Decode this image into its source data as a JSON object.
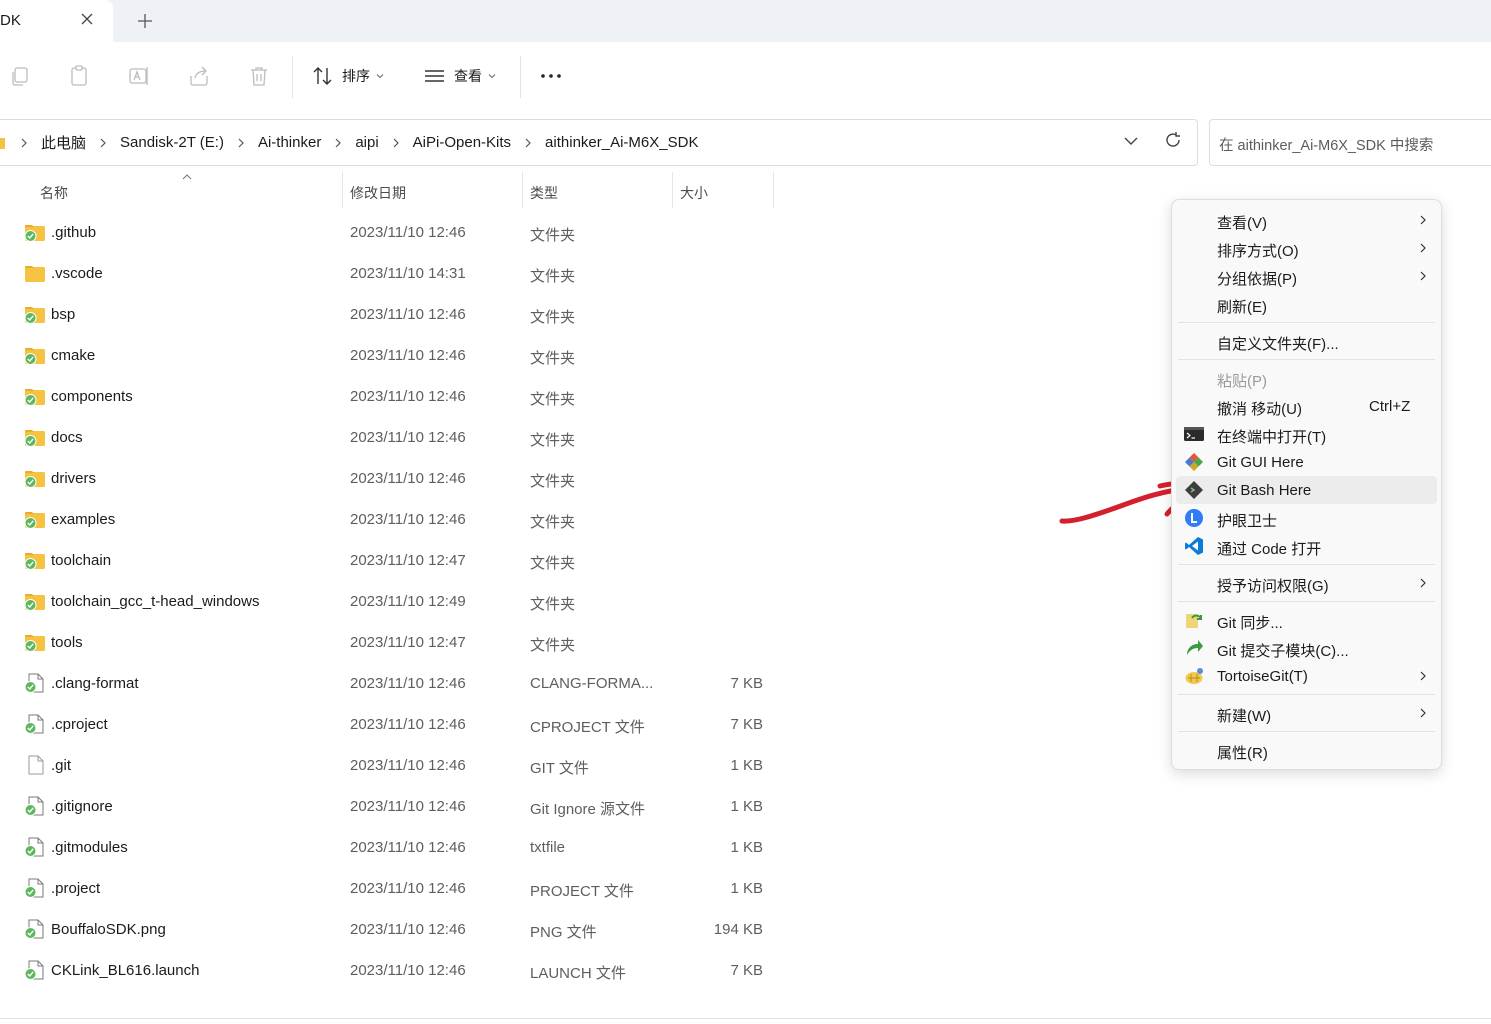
{
  "window": {
    "tab_title": "DK",
    "new_tab_label": "+"
  },
  "toolbar": {
    "sort_label": "排序",
    "view_label": "查看",
    "more_label": "..."
  },
  "address": {
    "breadcrumbs": [
      "此电脑",
      "Sandisk-2T (E:)",
      "Ai-thinker",
      "aipi",
      "AiPi-Open-Kits",
      "aithinker_Ai-M6X_SDK"
    ],
    "search_placeholder": "在 aithinker_Ai-M6X_SDK 中搜索"
  },
  "columns": {
    "name": "名称",
    "date": "修改日期",
    "type": "类型",
    "size": "大小"
  },
  "files": [
    {
      "name": ".github",
      "date": "2023/11/10 12:46",
      "type": "文件夹",
      "size": "",
      "icon": "folder-synced-icon"
    },
    {
      "name": ".vscode",
      "date": "2023/11/10 14:31",
      "type": "文件夹",
      "size": "",
      "icon": "folder-icon"
    },
    {
      "name": "bsp",
      "date": "2023/11/10 12:46",
      "type": "文件夹",
      "size": "",
      "icon": "folder-synced-icon"
    },
    {
      "name": "cmake",
      "date": "2023/11/10 12:46",
      "type": "文件夹",
      "size": "",
      "icon": "folder-synced-icon"
    },
    {
      "name": "components",
      "date": "2023/11/10 12:46",
      "type": "文件夹",
      "size": "",
      "icon": "folder-synced-icon"
    },
    {
      "name": "docs",
      "date": "2023/11/10 12:46",
      "type": "文件夹",
      "size": "",
      "icon": "folder-synced-icon"
    },
    {
      "name": "drivers",
      "date": "2023/11/10 12:46",
      "type": "文件夹",
      "size": "",
      "icon": "folder-synced-icon"
    },
    {
      "name": "examples",
      "date": "2023/11/10 12:46",
      "type": "文件夹",
      "size": "",
      "icon": "folder-synced-icon"
    },
    {
      "name": "toolchain",
      "date": "2023/11/10 12:47",
      "type": "文件夹",
      "size": "",
      "icon": "folder-synced-icon"
    },
    {
      "name": "toolchain_gcc_t-head_windows",
      "date": "2023/11/10 12:49",
      "type": "文件夹",
      "size": "",
      "icon": "folder-synced-icon"
    },
    {
      "name": "tools",
      "date": "2023/11/10 12:47",
      "type": "文件夹",
      "size": "",
      "icon": "folder-synced-icon"
    },
    {
      "name": ".clang-format",
      "date": "2023/11/10 12:46",
      "type": "CLANG-FORMA...",
      "size": "7 KB",
      "icon": "file-synced-icon"
    },
    {
      "name": ".cproject",
      "date": "2023/11/10 12:46",
      "type": "CPROJECT 文件",
      "size": "7 KB",
      "icon": "file-synced-icon"
    },
    {
      "name": ".git",
      "date": "2023/11/10 12:46",
      "type": "GIT 文件",
      "size": "1 KB",
      "icon": "file-icon"
    },
    {
      "name": ".gitignore",
      "date": "2023/11/10 12:46",
      "type": "Git Ignore 源文件",
      "size": "1 KB",
      "icon": "file-synced-icon"
    },
    {
      "name": ".gitmodules",
      "date": "2023/11/10 12:46",
      "type": "txtfile",
      "size": "1 KB",
      "icon": "file-synced-icon"
    },
    {
      "name": ".project",
      "date": "2023/11/10 12:46",
      "type": "PROJECT 文件",
      "size": "1 KB",
      "icon": "file-synced-icon"
    },
    {
      "name": "BouffaloSDK.png",
      "date": "2023/11/10 12:46",
      "type": "PNG 文件",
      "size": "194 KB",
      "icon": "file-synced-icon"
    },
    {
      "name": "CKLink_BL616.launch",
      "date": "2023/11/10 12:46",
      "type": "LAUNCH 文件",
      "size": "7 KB",
      "icon": "file-synced-icon"
    }
  ],
  "context_menu": {
    "view": "查看(V)",
    "sort_by": "排序方式(O)",
    "group_by": "分组依据(P)",
    "refresh": "刷新(E)",
    "customize": "自定义文件夹(F)...",
    "paste": "粘贴(P)",
    "undo_move": "撤消 移动(U)",
    "undo_shortcut": "Ctrl+Z",
    "open_terminal": "在终端中打开(T)",
    "git_gui": "Git GUI Here",
    "git_bash": "Git Bash Here",
    "eye_guard": "护眼卫士",
    "open_code": "通过 Code 打开",
    "grant_access": "授予访问权限(G)",
    "git_sync": "Git 同步...",
    "git_submodule": "Git 提交子模块(C)...",
    "tortoisegit": "TortoiseGit(T)",
    "new": "新建(W)",
    "properties": "属性(R)",
    "highlighted_item": "Git Bash Here"
  },
  "colors": {
    "accent_red": "#d4202e",
    "sync_green": "#5cb85c",
    "folder_yellow": "#f5c242",
    "vscode_blue": "#0a7bd6"
  }
}
